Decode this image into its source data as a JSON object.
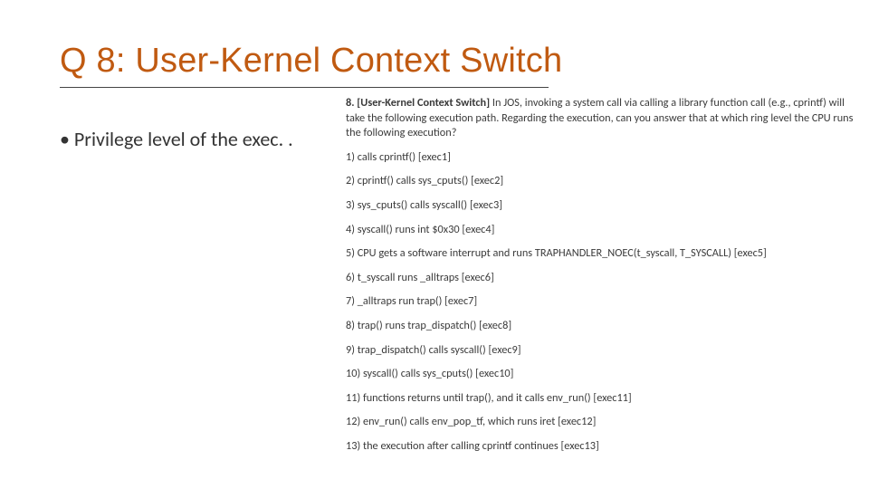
{
  "title": "Q 8: User-Kernel Context Switch",
  "bullet": "• Privilege level of the exec. .",
  "question": {
    "intro_bold": "8. [User-Kernel Context Switch] ",
    "intro_rest": "In JOS, invoking a system call via calling a library function call (e.g., cprintf) will take the following execution path. Regarding the execution, can you answer that at which ring level the CPU runs the following execution?",
    "steps": [
      "1) calls cprintf() [exec1]",
      "2) cprintf() calls sys_cputs() [exec2]",
      "3) sys_cputs() calls syscall() [exec3]",
      "4) syscall() runs int $0x30 [exec4]",
      "5) CPU gets a software interrupt and runs TRAPHANDLER_NOEC(t_syscall, T_SYSCALL) [exec5]",
      "6) t_syscall runs _alltraps [exec6]",
      "7) _alltraps run trap() [exec7]",
      "8) trap() runs trap_dispatch() [exec8]",
      "9) trap_dispatch() calls syscall() [exec9]",
      "10) syscall() calls sys_cputs() [exec10]",
      "11) functions returns until trap(), and it calls env_run() [exec11]",
      "12) env_run() calls env_pop_tf, which runs iret [exec12]",
      "13) the execution after calling cprintf continues [exec13]"
    ]
  }
}
